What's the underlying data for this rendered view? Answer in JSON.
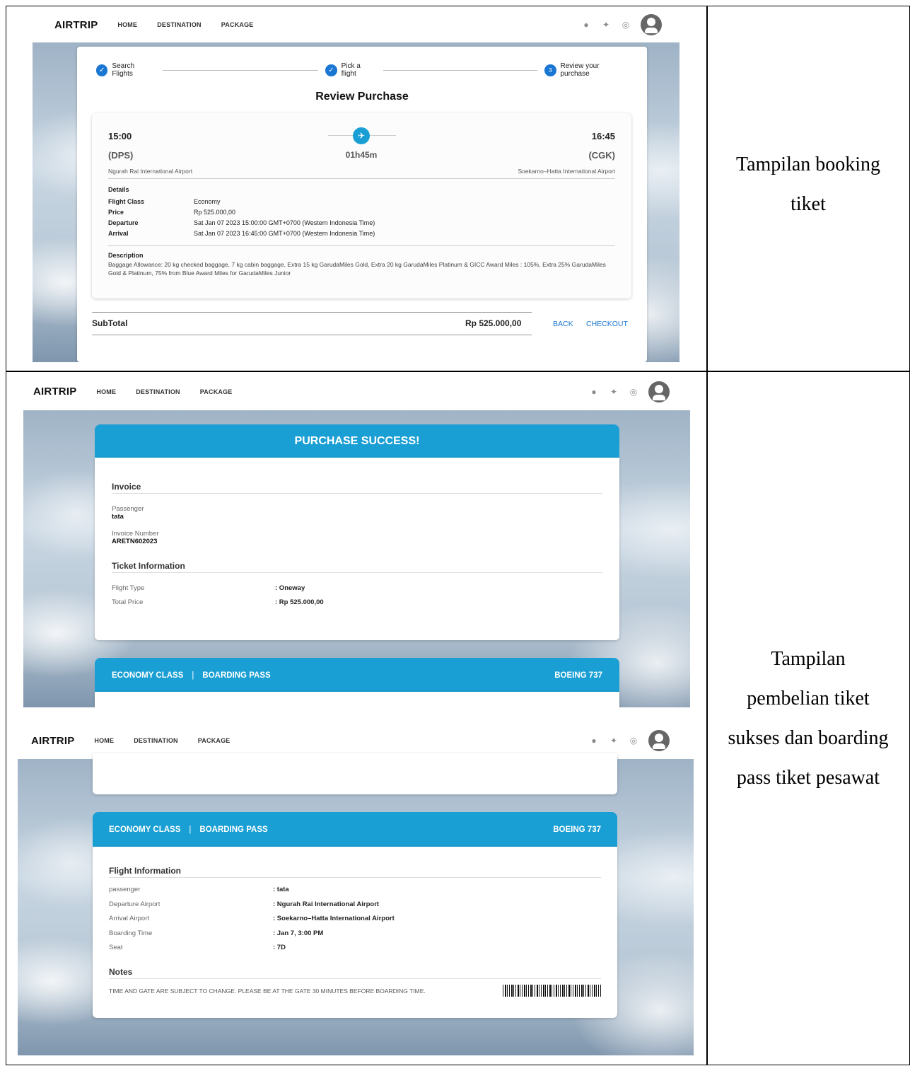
{
  "captions": {
    "row1": [
      "Tampilan booking",
      "tiket"
    ],
    "row2": [
      "Tampilan",
      "pembelian tiket",
      "sukses dan boarding",
      "pass tiket pesawat"
    ]
  },
  "nav": {
    "brand": "AIRTRIP",
    "links": [
      "HOME",
      "DESTINATION",
      "PACKAGE"
    ],
    "social_icons": [
      "facebook-icon",
      "twitter-icon",
      "instagram-icon"
    ]
  },
  "review": {
    "steps": [
      "Search Flights",
      "Pick a flight",
      "Review your purchase"
    ],
    "step3_number": "3",
    "title": "Review Purchase",
    "depart_time": "15:00",
    "arrive_time": "16:45",
    "depart_code": "(DPS)",
    "arrive_code": "(CGK)",
    "duration": "01h45m",
    "depart_airport": "Ngurah Rai International Airport",
    "arrive_airport": "Soekarno–Hatta International Airport",
    "details_title": "Details",
    "details": [
      {
        "k": "Flight Class",
        "v": "Economy"
      },
      {
        "k": "Price",
        "v": "Rp 525.000,00"
      },
      {
        "k": "Departure",
        "v": "Sat Jan 07 2023 15:00:00 GMT+0700 (Western Indonesia Time)"
      },
      {
        "k": "Arrival",
        "v": "Sat Jan 07 2023 16:45:00 GMT+0700 (Western Indonesia Time)"
      }
    ],
    "description_title": "Description",
    "description": "Baggage Allowance: 20 kg checked baggage, 7 kg cabin baggage, Extra 15 kg GarudaMiles Gold, Extra 20 kg GarudaMiles Platinum & GICC Award Miles : 105%, Extra 25% GarudaMiles Gold & Platinum, 75% from Blue Award Miles for GarudaMiles Junior",
    "subtotal_label": "SubTotal",
    "subtotal_value": "Rp 525.000,00",
    "back": "BACK",
    "checkout": "CHECKOUT"
  },
  "success": {
    "title": "PURCHASE SUCCESS!",
    "invoice_title": "Invoice",
    "passenger_label": "Passenger",
    "passenger": "tata",
    "invoice_number_label": "Invoice Number",
    "invoice_number": "ARETN602023",
    "ticket_info_title": "Ticket Information",
    "flight_type_label": "Flight Type",
    "flight_type": ": Oneway",
    "total_price_label": "Total Price",
    "total_price": ": Rp 525.000,00"
  },
  "boarding": {
    "class": "ECONOMY CLASS",
    "separator": "|",
    "pass": "BOARDING PASS",
    "aircraft": "BOEING 737",
    "flight_info_title": "Flight Information",
    "rows": [
      {
        "k": "passenger",
        "v": ": tata"
      },
      {
        "k": "Departure Airport",
        "v": ": Ngurah Rai International Airport"
      },
      {
        "k": "Arrival Airport",
        "v": ": Soekarno–Hatta International Airport"
      },
      {
        "k": "Boarding Time",
        "v": ": Jan 7, 3:00 PM"
      },
      {
        "k": "Seat",
        "v": ": 7D"
      }
    ],
    "notes_title": "Notes",
    "notes": "TIME AND GATE ARE SUBJECT TO CHANGE. PLEASE BE AT THE GATE 30 MINUTES BEFORE BOARDING TIME."
  }
}
